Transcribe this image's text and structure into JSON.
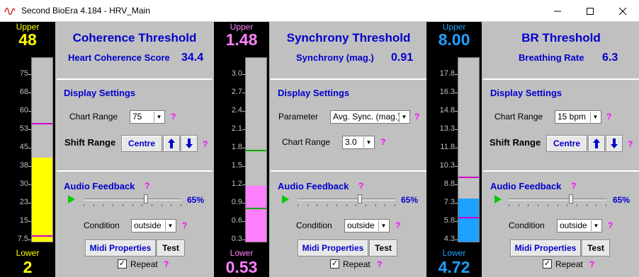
{
  "window": {
    "title": "Second BioEra 4.184 - HRV_Main"
  },
  "meters": [
    {
      "upper_label": "Upper",
      "upper_value": "48",
      "lower_label": "Lower",
      "lower_value": "2",
      "text_color": "#ffff00",
      "fill_color": "#ffff00",
      "mark_color": "#cc00cc",
      "ticks": [
        "75",
        "68",
        "60",
        "53",
        "45",
        "38",
        "30",
        "23",
        "15",
        "7.5"
      ],
      "range_min": 0,
      "range_max": 75,
      "fill_value": 34.4,
      "upper_mark": 48,
      "lower_mark": 2
    },
    {
      "upper_label": "Upper",
      "upper_value": "1.48",
      "lower_label": "Lower",
      "lower_value": "0.53",
      "text_color": "#ff80ff",
      "fill_color": "#ff80ff",
      "mark_color": "#00aa00",
      "ticks": [
        "3.0",
        "2.7",
        "2.4",
        "2.1",
        "1.8",
        "1.5",
        "1.2",
        "0.9",
        "0.6",
        "0.3"
      ],
      "range_min": 0,
      "range_max": 3.0,
      "fill_value": 0.91,
      "upper_mark": 1.48,
      "lower_mark": 0.53
    },
    {
      "upper_label": "Upper",
      "upper_value": "8.00",
      "lower_label": "Lower",
      "lower_value": "4.72",
      "text_color": "#1ea0ff",
      "fill_color": "#1ea0ff",
      "mark_color": "#cc00cc",
      "ticks": [
        "17.8",
        "16.3",
        "14.8",
        "13.3",
        "11.8",
        "10.3",
        "8.8",
        "7.3",
        "5.8",
        "4.3"
      ],
      "range_min": 2.8,
      "range_max": 17.8,
      "fill_value": 6.3,
      "upper_mark": 8.0,
      "lower_mark": 4.72
    }
  ],
  "panels": [
    {
      "title": "Coherence Threshold",
      "score_label": "Heart Coherence Score",
      "score_value": "34.4",
      "display_heading": "Display Settings",
      "chart_range_label": "Chart Range",
      "chart_range_value": "75",
      "shift_label": "Shift Range",
      "centre_label": "Centre",
      "audio_heading": "Audio Feedback",
      "volume": "65%",
      "condition_label": "Condition",
      "condition_value": "outside",
      "midi_label": "Midi Properties",
      "test_label": "Test",
      "repeat_label": "Repeat",
      "help": "?"
    },
    {
      "title": "Synchrony Threshold",
      "score_label": "Synchrony (mag.)",
      "score_value": "0.91",
      "display_heading": "Display Settings",
      "parameter_label": "Parameter",
      "parameter_value": "Avg. Sync. (mag.)",
      "chart_range_label": "Chart Range",
      "chart_range_value": "3.0",
      "audio_heading": "Audio Feedback",
      "volume": "65%",
      "condition_label": "Condition",
      "condition_value": "outside",
      "midi_label": "Midi Properties",
      "test_label": "Test",
      "repeat_label": "Repeat",
      "help": "?"
    },
    {
      "title": "BR Threshold",
      "score_label": "Breathing Rate",
      "score_value": "6.3",
      "display_heading": "Display Settings",
      "chart_range_label": "Chart Range",
      "chart_range_value": "15 bpm",
      "shift_label": "Shift Range",
      "centre_label": "Centre",
      "audio_heading": "Audio Feedback",
      "volume": "65%",
      "condition_label": "Condition",
      "condition_value": "outside",
      "midi_label": "Midi Properties",
      "test_label": "Test",
      "repeat_label": "Repeat",
      "help": "?"
    }
  ]
}
